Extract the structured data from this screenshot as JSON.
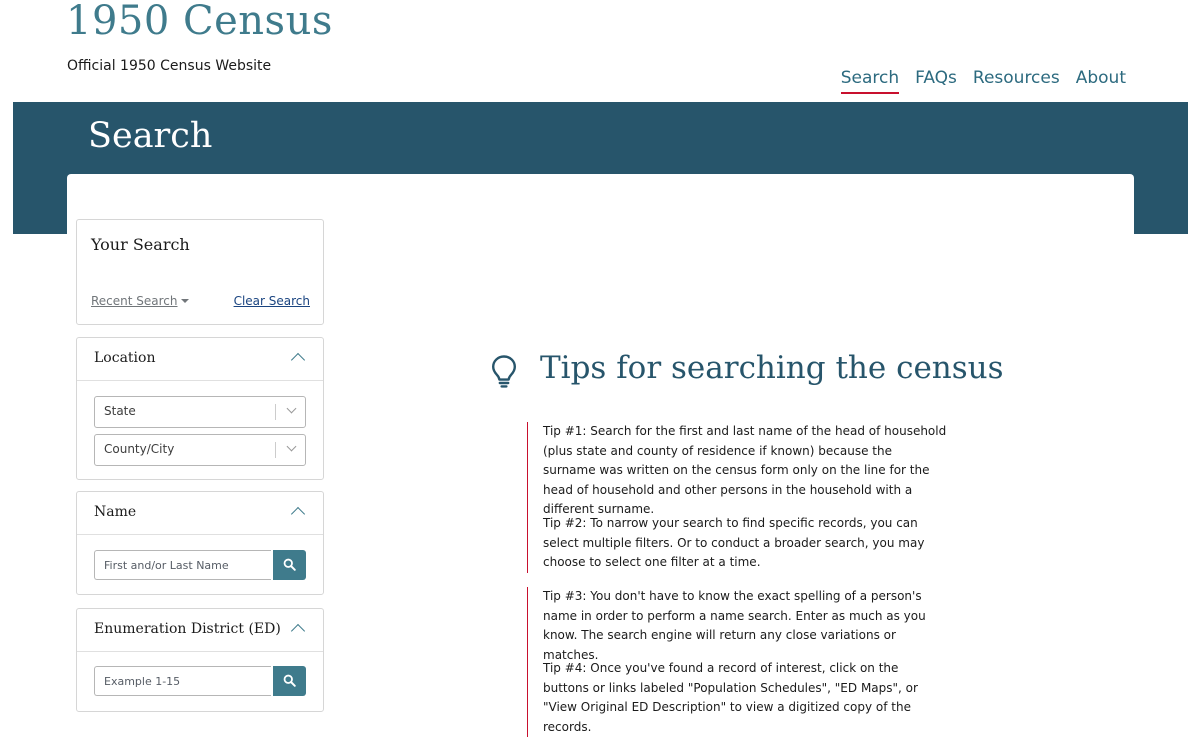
{
  "site": {
    "title": "1950 Census",
    "subtitle": "Official 1950 Census Website"
  },
  "nav": {
    "items": [
      {
        "label": "Search",
        "active": true
      },
      {
        "label": "FAQs",
        "active": false
      },
      {
        "label": "Resources",
        "active": false
      },
      {
        "label": "About",
        "active": false
      }
    ]
  },
  "banner": {
    "title": "Search"
  },
  "your_search": {
    "title": "Your Search",
    "recent_label": "Recent Search",
    "clear_label": "Clear Search"
  },
  "filters": {
    "location": {
      "title": "Location",
      "state_placeholder": "State",
      "county_placeholder": "County/City"
    },
    "name": {
      "title": "Name",
      "placeholder": "First and/or Last Name",
      "value": ""
    },
    "ed": {
      "title": "Enumeration District (ED)",
      "placeholder": "Example 1-15",
      "value": ""
    }
  },
  "tips": {
    "title": "Tips for searching the census",
    "items": [
      "Tip #1: Search for the first and last name of the head of household (plus state and county of residence if known) because the surname was written on the census form only on the line for the head of household and other persons in the household with a different surname.",
      "Tip #2: To narrow your search to find specific records, you can select multiple filters. Or to conduct a broader search, you may choose to select one filter at a time.",
      "Tip #3: You don't have to know the exact spelling of a person's name in order to perform a name search. Enter as much as you know. The search engine will return any close variations or matches.",
      "Tip #4: Once you've found a record of interest, click on the buttons or links labeled \"Population Schedules\", \"ED Maps\", or \"View Original ED Description\" to view a digitized copy of the records."
    ]
  },
  "colors": {
    "brand_teal": "#3f7b8c",
    "banner_bg": "#27556b",
    "accent_red": "#c8102e"
  },
  "icons": {
    "search_button": "magnifying-glass-icon",
    "tips": "lightbulb-icon",
    "collapse": "chevron-up-icon",
    "select": "chevron-down-icon"
  }
}
